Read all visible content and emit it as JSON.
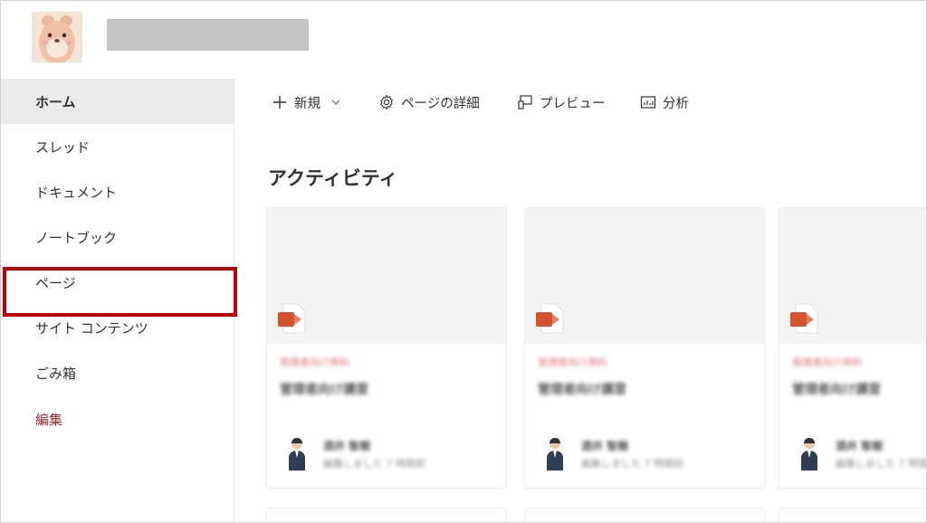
{
  "header": {
    "logo_icon": "hamster-avatar-icon"
  },
  "sidebar": {
    "items": [
      {
        "label": "ホーム",
        "state": "active"
      },
      {
        "label": "スレッド"
      },
      {
        "label": "ドキュメント"
      },
      {
        "label": "ノートブック"
      },
      {
        "label": "ページ"
      },
      {
        "label": "サイト コンテンツ"
      },
      {
        "label": "ごみ箱",
        "state": "highlighted"
      },
      {
        "label": "編集",
        "style": "link"
      }
    ]
  },
  "commandbar": {
    "new_label": "新規",
    "page_details_label": "ページの詳細",
    "preview_label": "プレビュー",
    "analytics_label": "分析"
  },
  "main": {
    "section_title": "アクティビティ",
    "cards": [
      {
        "category": "管理者向け資料",
        "title": "管理者向け講習",
        "author": "酒井 智樹",
        "meta": "編集しました 7 時間前"
      },
      {
        "category": "管理者向け資料",
        "title": "管理者向け講習",
        "author": "酒井 智樹",
        "meta": "編集しました 7 時間前"
      },
      {
        "category": "管理者向け資料",
        "title": "管理者向け講習",
        "author": "酒井 智樹",
        "meta": "編集しました 7 時間前"
      }
    ]
  },
  "colors": {
    "highlight": "#c00000",
    "edit_link": "#a4262c",
    "active_nav_bg": "#edebe9",
    "powerpoint_orange": "#d35230"
  }
}
